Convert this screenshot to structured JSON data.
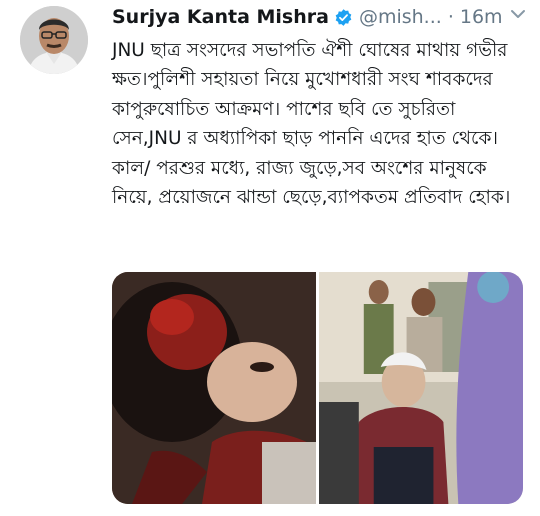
{
  "tweet": {
    "author_name": "Surjya Kanta Mishra",
    "handle": "@mish...",
    "separator": "·",
    "time": "16m",
    "verified": true,
    "text": "JNU ছাত্র সংসদের সভাপতি ঐশী ঘোষের মাথায় গভীর ক্ষত।পুলিশী সহায়তা নিয়ে মুখোশধারী সংঘ শাবকদের কাপুরুষোচিত আক্রমণ। পাশের ছবি তে সুচরিতা সেন,JNU র অধ্যাপিকা ছাড় পাননি এদের হাত থেকে। কাল/ পরশুর মধ্যে, রাজ্য জুড়ে,সব অংশের মানুষকে নিয়ে, প্রয়োজনে ঝান্ডা ছেড়ে,ব্যাপকতম প্রতিবাদ হোক।",
    "media_count": 2
  },
  "icons": {
    "verified": "verified-badge-icon",
    "more": "chevron-down-icon"
  },
  "colors": {
    "name": "#14171a",
    "muted": "#657786",
    "verified": "#1da1f2",
    "text": "#14171a"
  }
}
